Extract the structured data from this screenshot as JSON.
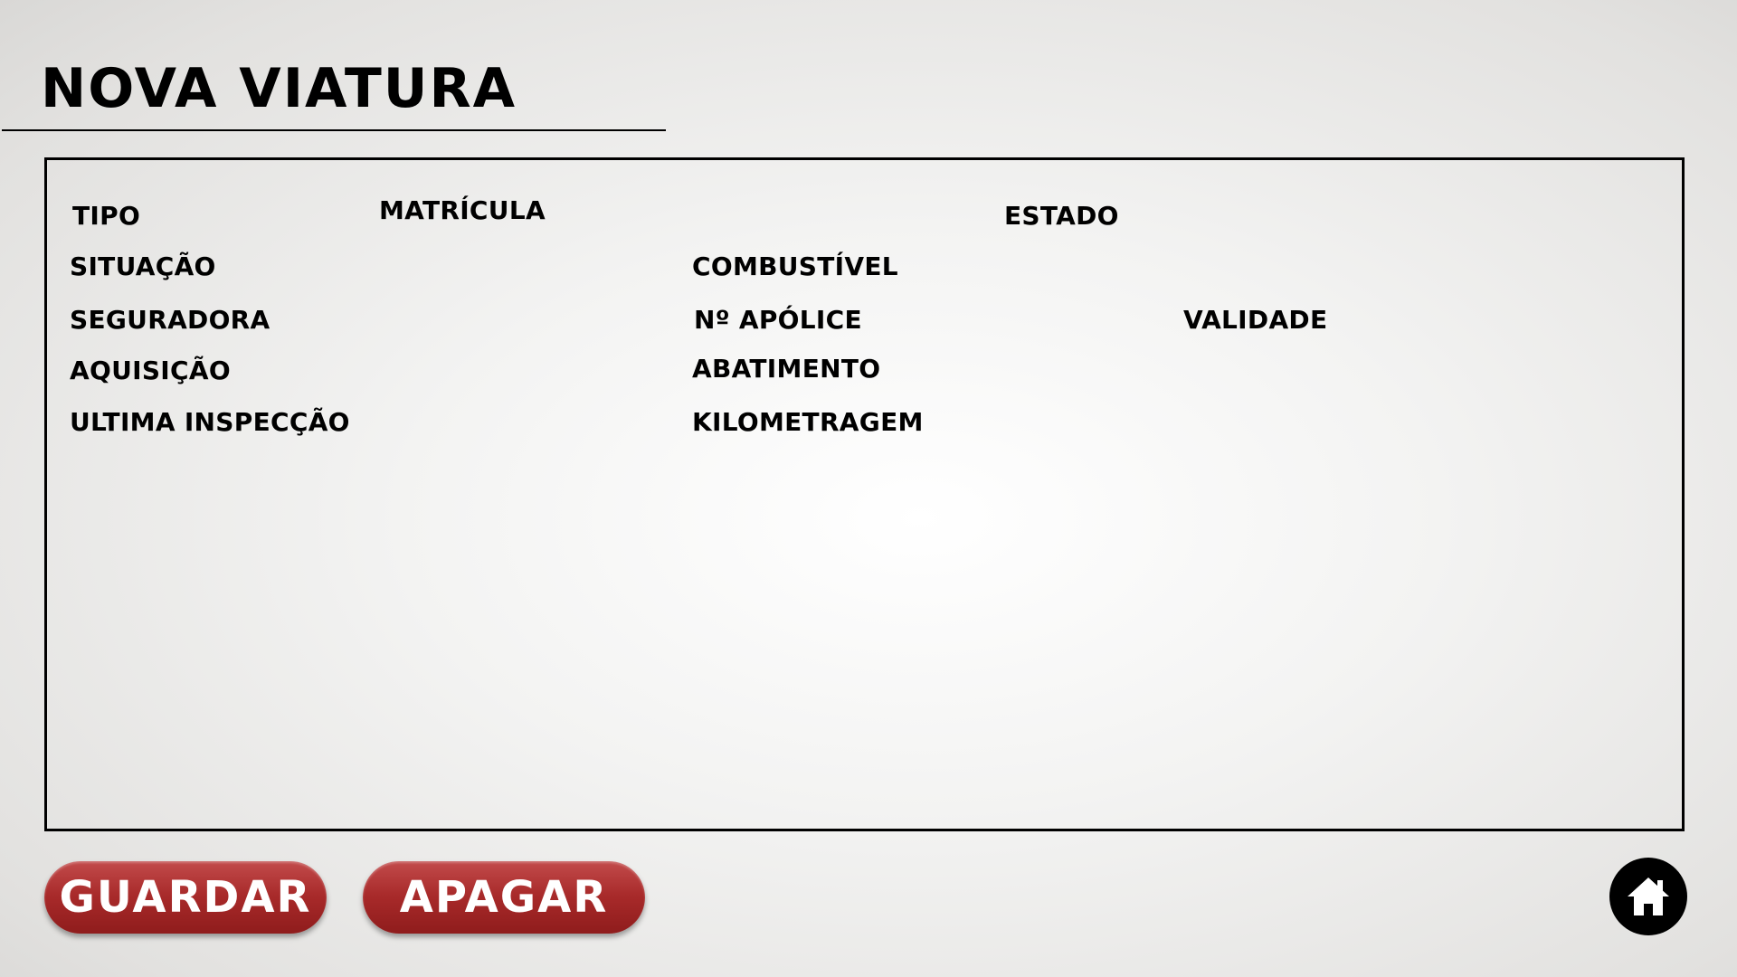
{
  "header": {
    "title": "NOVA VIATURA"
  },
  "form": {
    "labels": {
      "tipo": "TIPO",
      "matricula": "MATRÍCULA",
      "estado": "ESTADO",
      "situacao": "SITUAÇÃO",
      "combustivel": "COMBUSTÍVEL",
      "seguradora": "SEGURADORA",
      "n_apolice": "Nº APÓLICE",
      "validade": "VALIDADE",
      "aquisicao": "AQUISIÇÃO",
      "abatimento": "ABATIMENTO",
      "ultima_inspeccao": "ULTIMA INSPECÇÃO",
      "kilometragem": "KILOMETRAGEM"
    }
  },
  "actions": {
    "save_label": "GUARDAR",
    "delete_label": "APAGAR",
    "home_icon": "home-icon"
  },
  "colors": {
    "button_red": "#a82a2a",
    "home_bg": "#000000",
    "home_icon": "#ffffff"
  }
}
